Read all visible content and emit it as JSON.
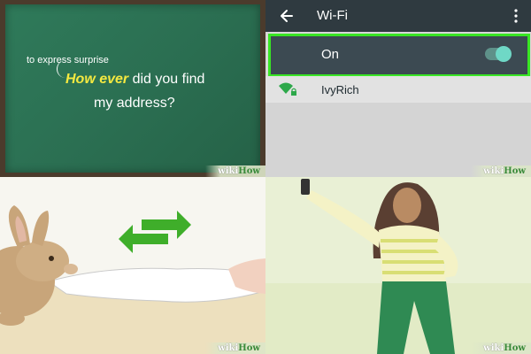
{
  "panel1": {
    "small_note": "to express surprise",
    "highlight": "How ever",
    "line1_rest": " did you find",
    "line2": "my address?",
    "board_color": "#2b6f52",
    "highlight_color": "#f5e940"
  },
  "panel2": {
    "title": "Wi-Fi",
    "toggle_label": "On",
    "toggle_state": "on",
    "network_name": "IvyRich",
    "highlight_border_color": "#39e624",
    "appbar_color": "#2f3a40",
    "icons": [
      "back-arrow-icon",
      "overflow-menu-icon",
      "wifi-lock-icon"
    ]
  },
  "panel3": {
    "arrow_color": "#3fae2a",
    "icons": [
      "swap-arrows-icon"
    ]
  },
  "panel4": {},
  "watermark": {
    "wiki": "wiki",
    "how": "How"
  }
}
